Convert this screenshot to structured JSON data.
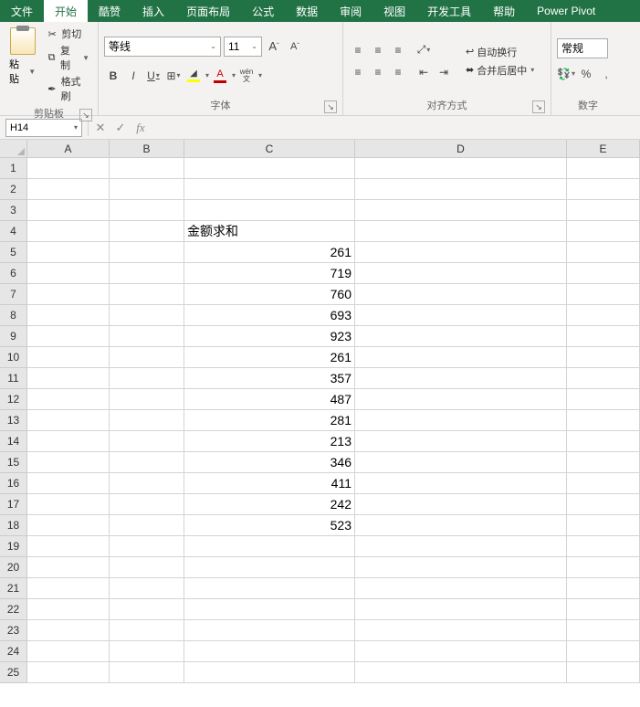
{
  "tabs": [
    "文件",
    "开始",
    "酷赞",
    "插入",
    "页面布局",
    "公式",
    "数据",
    "审阅",
    "视图",
    "开发工具",
    "帮助",
    "Power Pivot"
  ],
  "active_tab": 1,
  "clipboard": {
    "paste": "粘贴",
    "cut": "剪切",
    "copy": "复制",
    "format_painter": "格式刷",
    "label": "剪贴板"
  },
  "font": {
    "name": "等线",
    "size": "11",
    "label": "字体",
    "wen": "wén"
  },
  "align": {
    "wrap": "自动换行",
    "merge": "合并后居中",
    "label": "对齐方式"
  },
  "number": {
    "format": "常规",
    "label": "数字",
    "percent": "%"
  },
  "namebox": "H14",
  "fx_label": "fx",
  "col_widths": {
    "A": 90,
    "B": 82,
    "C": 187,
    "D": 232,
    "E": 80
  },
  "columns": [
    "A",
    "B",
    "C",
    "D",
    "E"
  ],
  "row_count": 25,
  "c4_text": "金额求和",
  "c_values": {
    "5": "261",
    "6": "719",
    "7": "760",
    "8": "693",
    "9": "923",
    "10": "261",
    "11": "357",
    "12": "487",
    "13": "281",
    "14": "213",
    "15": "346",
    "16": "411",
    "17": "242",
    "18": "523"
  }
}
